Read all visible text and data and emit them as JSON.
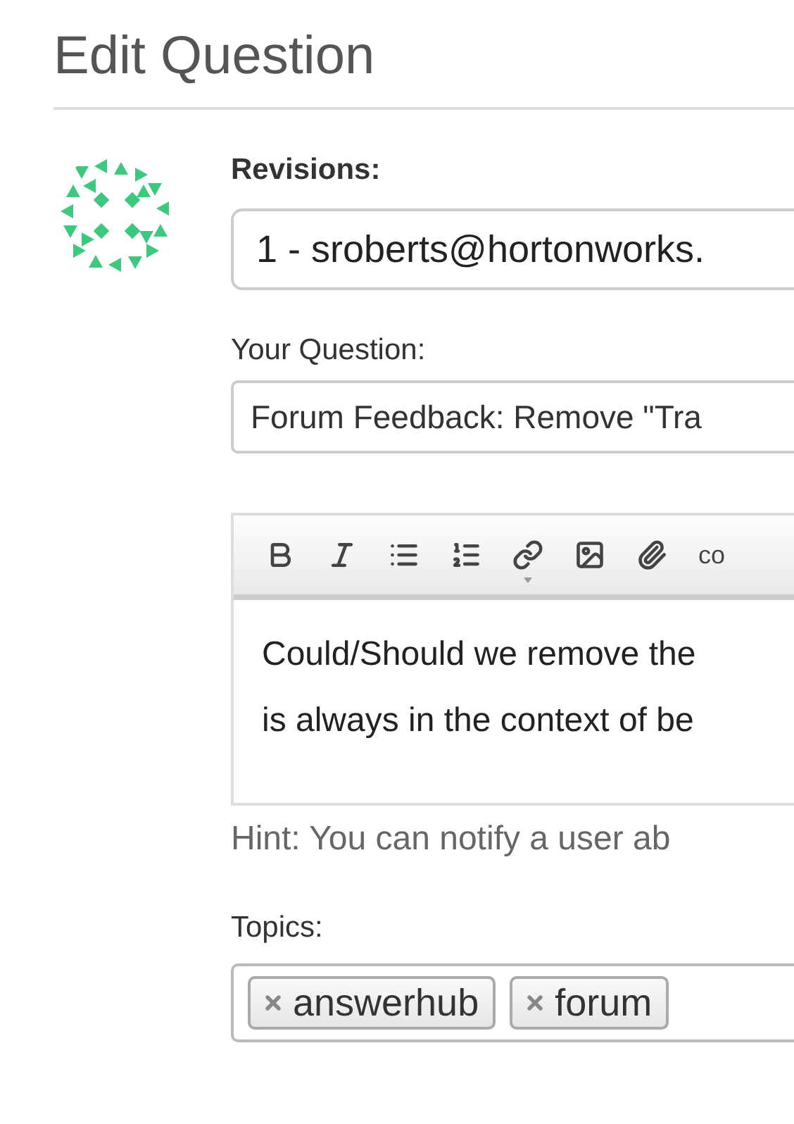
{
  "page_title": "Edit Question",
  "revisions": {
    "label": "Revisions:",
    "value": "1 - sroberts@hortonworks."
  },
  "question": {
    "label": "Your Question:",
    "value": "Forum Feedback: Remove \"Tra"
  },
  "editor": {
    "toolbar": [
      {
        "kind": "bold"
      },
      {
        "kind": "italic"
      },
      {
        "kind": "bullets"
      },
      {
        "kind": "numbers"
      },
      {
        "kind": "link"
      },
      {
        "kind": "image"
      },
      {
        "kind": "attach"
      },
      {
        "kind": "text",
        "label": "co"
      }
    ],
    "lines": [
      "Could/Should we remove the",
      "is always in the context of be"
    ]
  },
  "hint": "Hint: You can notify a user ab",
  "topics": {
    "label": "Topics:",
    "tags": [
      "answerhub",
      "forum"
    ]
  }
}
